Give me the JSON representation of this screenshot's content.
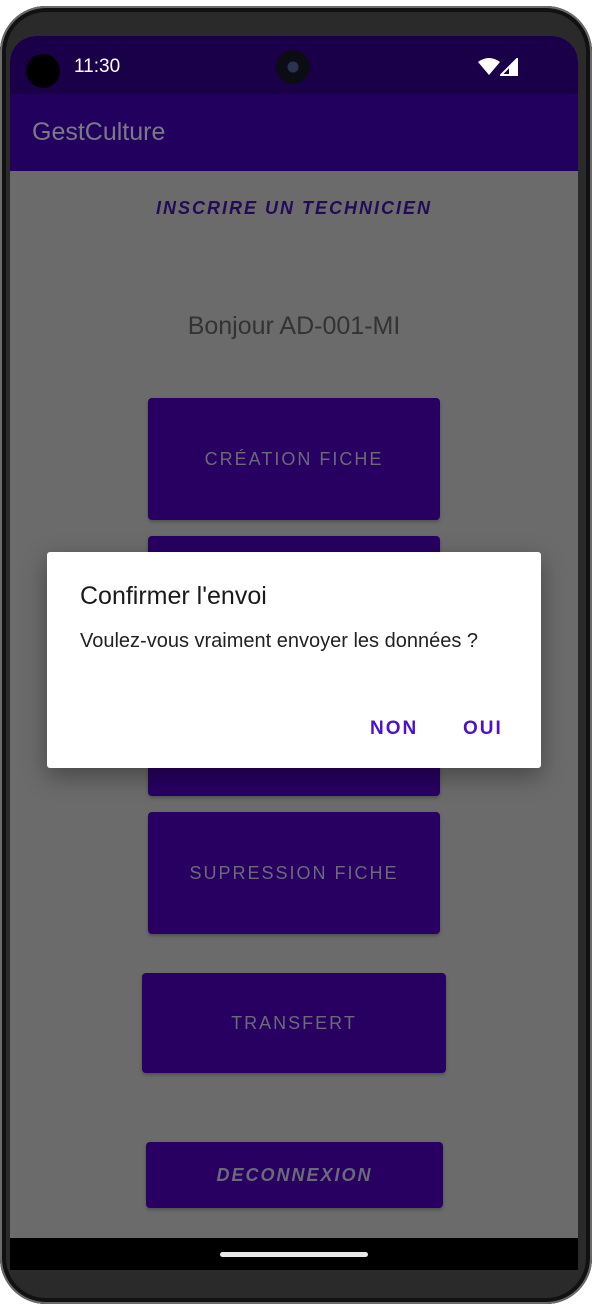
{
  "status_bar": {
    "time": "11:30",
    "icons": [
      "wifi-icon",
      "cellular-signal-icon"
    ]
  },
  "app_bar": {
    "title": "GestCulture"
  },
  "main": {
    "subtitle": "INSCRIRE UN TECHNICIEN",
    "greeting": "Bonjour AD-001-MI",
    "buttons": [
      {
        "label": "CRÉATION FICHE"
      },
      {
        "label": ""
      },
      {
        "label": ""
      },
      {
        "label": "SUPRESSION FICHE"
      },
      {
        "label": "TRANSFERT"
      },
      {
        "label": "DECONNEXION"
      }
    ]
  },
  "dialog": {
    "title": "Confirmer l'envoi",
    "message": "Voulez-vous vraiment envoyer les données ?",
    "negative_label": "NON",
    "positive_label": "OUI"
  },
  "colors": {
    "primary": "#22005e",
    "button": "#270061",
    "accent": "#4d10d0",
    "status_bar": "#1a0048"
  }
}
